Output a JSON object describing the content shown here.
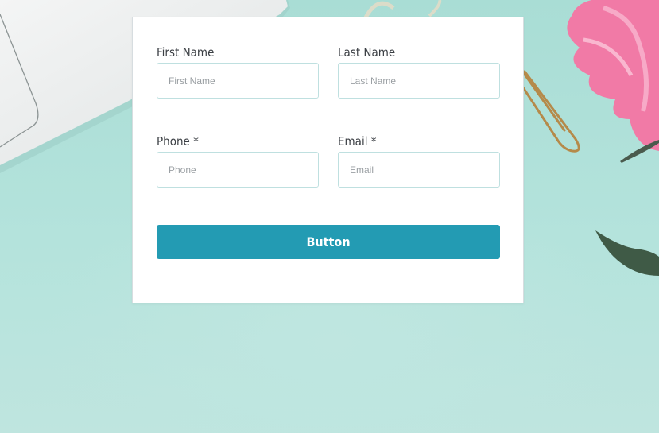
{
  "form": {
    "first_name": {
      "label": "First Name",
      "placeholder": "First Name"
    },
    "last_name": {
      "label": "Last Name",
      "placeholder": "Last Name"
    },
    "phone": {
      "label": "Phone *",
      "placeholder": "Phone"
    },
    "email": {
      "label": "Email *",
      "placeholder": "Email"
    },
    "submit_label": "Button"
  },
  "colors": {
    "background": "#b7e2dc",
    "button": "#239bb3",
    "input_border": "#bfe0e0"
  },
  "decor": [
    "laptop",
    "paper-clip",
    "pink-flower",
    "leaf",
    "ring"
  ]
}
